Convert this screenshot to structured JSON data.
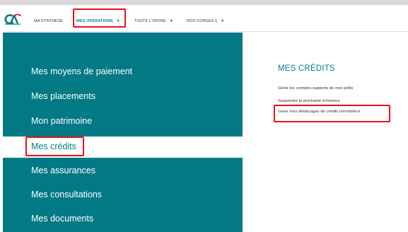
{
  "brand": {
    "logo_icon": "ca-logo-icon",
    "colors": {
      "teal": "#017a85",
      "teal_text": "#00808a",
      "highlight_red": "#e8101c"
    }
  },
  "topnav": {
    "items": [
      {
        "label": "MA SYNTHÈSE",
        "has_caret": false
      },
      {
        "label": "MES OPÉRATIONS",
        "has_caret": true,
        "active": true
      },
      {
        "label": "TOUTE L'OFFRE",
        "has_caret": true
      },
      {
        "label": "NOS CONSEILS",
        "has_caret": true
      }
    ],
    "caret_glyph": "▼"
  },
  "leftmenu": {
    "items": [
      {
        "label": "Mes moyens de paiement"
      },
      {
        "label": "Mes placements"
      },
      {
        "label": "Mon patrimoine"
      },
      {
        "label": "Mes crédits",
        "active": true
      },
      {
        "label": "Mes assurances"
      },
      {
        "label": "Mes consultations"
      },
      {
        "label": "Mes documents"
      }
    ]
  },
  "credits_panel": {
    "title": "MES CRÉDITS",
    "links": [
      {
        "label": "Gérer les comptes supports de mes prêts"
      },
      {
        "label": "Suspendre la prochaine échéance"
      },
      {
        "label": "Gérer mes déblocages de crédits immobiliers",
        "highlighted": true
      }
    ]
  }
}
